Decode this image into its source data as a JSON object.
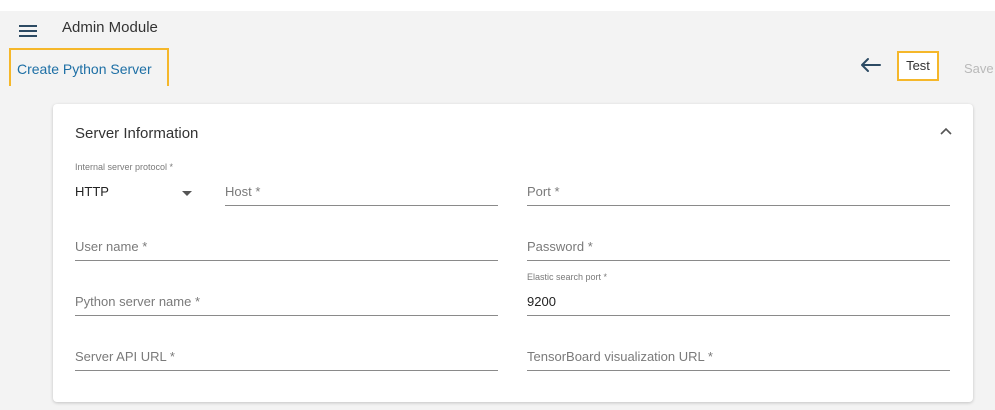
{
  "header": {
    "module_title": "Admin Module"
  },
  "subheader": {
    "page_title": "Create Python Server",
    "test_label": "Test",
    "save_label": "Save"
  },
  "section": {
    "title": "Server Information"
  },
  "form": {
    "protocol": {
      "label": "Internal server protocol *",
      "value": "HTTP"
    },
    "host": {
      "placeholder": "Host *"
    },
    "port": {
      "placeholder": "Port *"
    },
    "username": {
      "placeholder": "User name *"
    },
    "password": {
      "placeholder": "Password *"
    },
    "python_server_name": {
      "placeholder": "Python server name *"
    },
    "elastic_port": {
      "label": "Elastic search port *",
      "value": "9200"
    },
    "server_api_url": {
      "placeholder": "Server API URL *"
    },
    "tensorboard_url": {
      "placeholder": "TensorBoard visualization URL *"
    }
  },
  "colors": {
    "accent_highlight": "#f5b72a",
    "link_blue": "#1d6fa5",
    "background": "#f3f3f3"
  },
  "icons": {
    "menu": "hamburger-menu-icon",
    "back": "arrow-left-icon",
    "collapse": "chevron-up-icon",
    "dropdown": "caret-down-icon"
  }
}
